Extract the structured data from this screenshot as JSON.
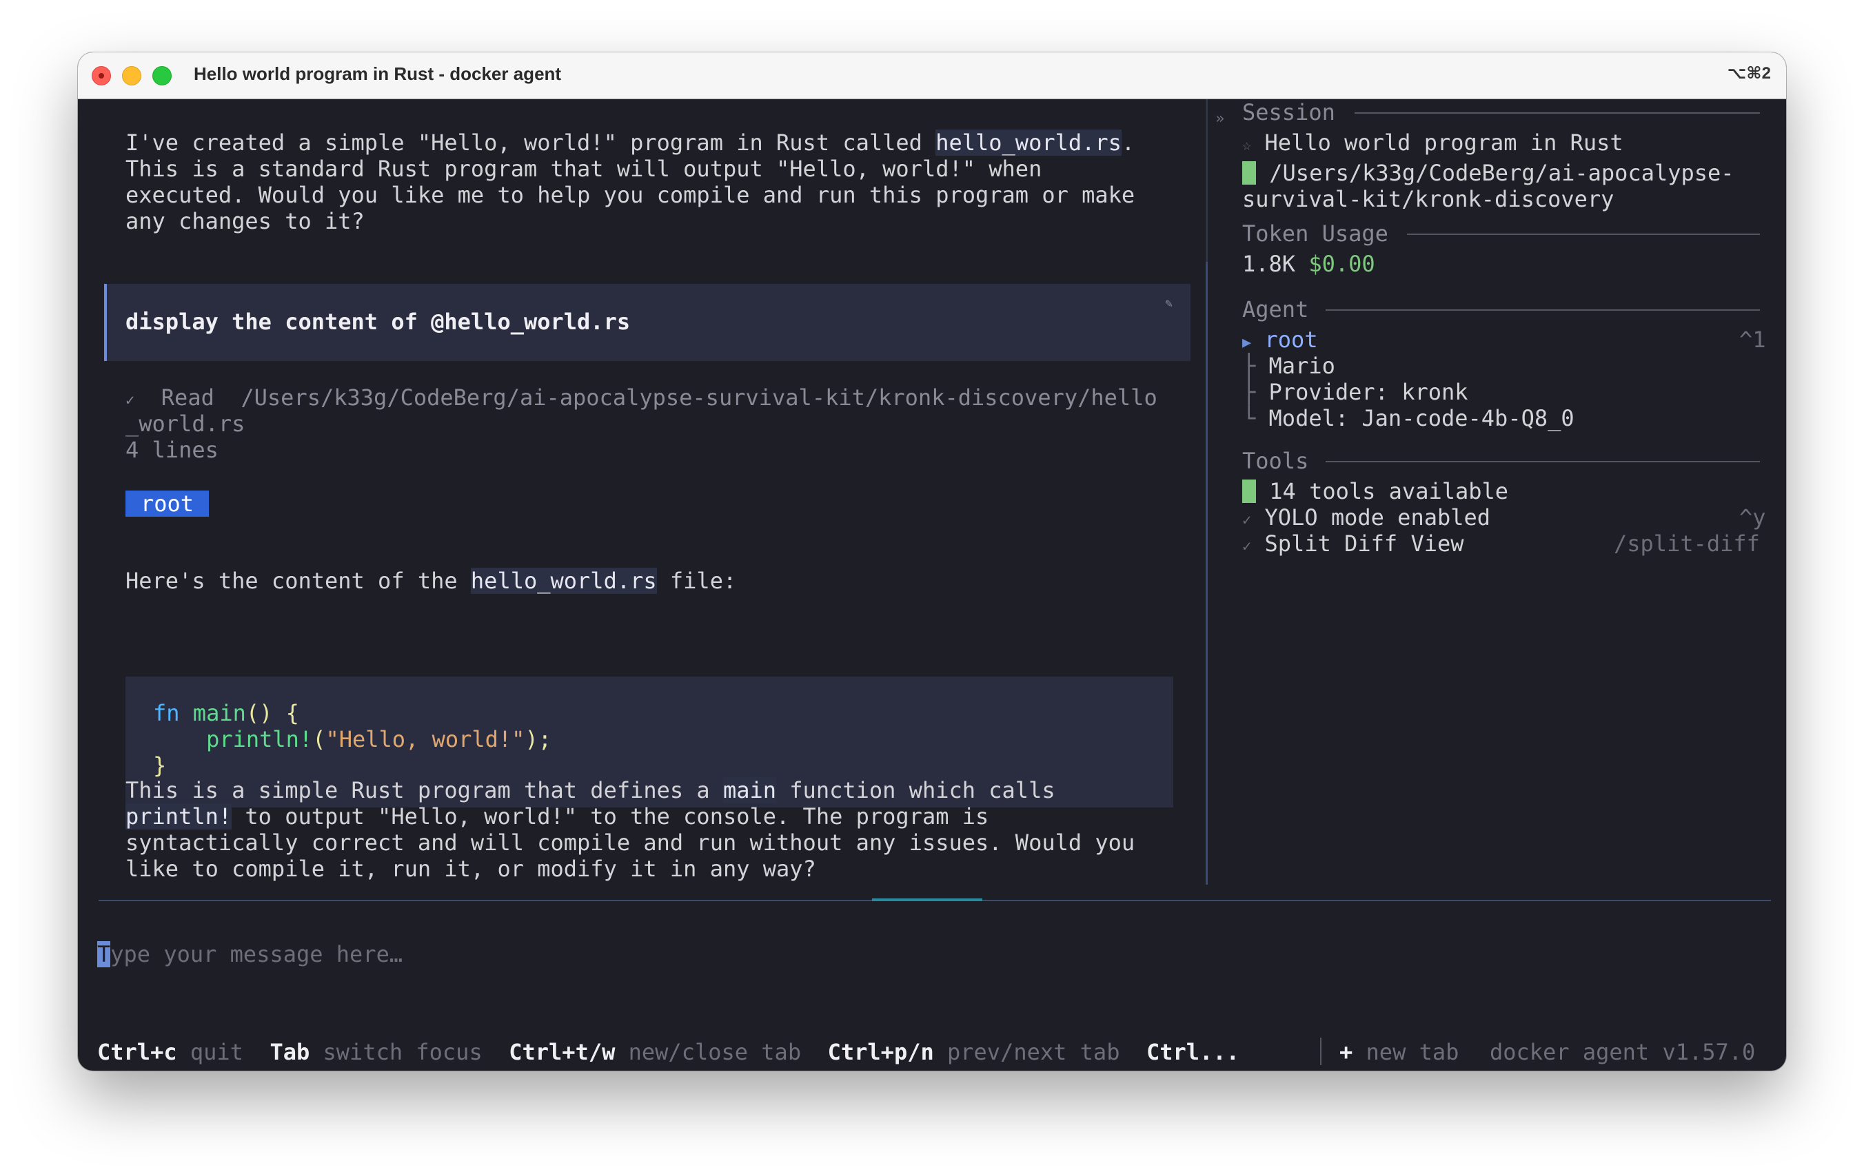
{
  "window": {
    "title": "Hello world program in Rust - docker agent",
    "shortcut": "⌥⌘2"
  },
  "chat": {
    "assistant_intro_lines": [
      "I've created a simple \"Hello, world!\" program in Rust called ",
      "hello_world.rs",
      ".",
      "This is a standard Rust program that will output \"Hello, world!\" when",
      "executed. Would you like me to help you compile and run this program or make",
      "any changes to it?"
    ],
    "user_message": "display the content of @hello_world.rs",
    "edit_icon": "pencil-icon",
    "tool_call": {
      "check": "✓",
      "label": "Read",
      "path_line1": "/Users/k33g/CodeBerg/ai-apocalypse-survival-kit/kronk-discovery/hello",
      "path_line2": "_world.rs",
      "result": "4 lines"
    },
    "agent_badge": "root",
    "reply_prefix": "Here's the content of the ",
    "reply_file": "hello_world.rs",
    "reply_suffix": " file:",
    "code": {
      "kw": "fn",
      "name": "main",
      "sig_rest": "() {",
      "macro": "println!",
      "paren_open": "(",
      "string": "\"Hello, world!\"",
      "paren_close": ");",
      "close": "}"
    },
    "explain": {
      "l1_a": "This is a simple Rust program that defines a ",
      "l1_code": "main",
      "l1_b": " function which calls",
      "l2_code": "println!",
      "l2_b": " to output \"Hello, world!\" to the console. The program is",
      "l3": "syntactically correct and will compile and run without any issues. Would you",
      "l4": "like to compile it, run it, or modify it in any way?"
    }
  },
  "sidebar": {
    "collapse": "»",
    "session": {
      "header": "Session",
      "star": "☆",
      "title": "Hello world program in Rust",
      "path_line1": "/Users/k33g/CodeBerg/ai-apocalypse-",
      "path_line2": "survival-kit/kronk-discovery"
    },
    "tokens": {
      "header": "Token Usage",
      "count": "1.8K",
      "cost": "$0.00"
    },
    "agent": {
      "header": "Agent",
      "arrow": "▶",
      "name": "root",
      "shortcut": "^1",
      "lines": [
        {
          "branch": "├",
          "text": "Mario"
        },
        {
          "branch": "├",
          "text": "Provider: kronk"
        },
        {
          "branch": "└",
          "text": "Model: Jan-code-4b-Q8_0"
        }
      ]
    },
    "tools": {
      "header": "Tools",
      "available": "14 tools available",
      "yolo": "YOLO mode enabled",
      "yolo_shortcut": "^y",
      "split": "Split Diff View",
      "split_command": "/split-diff",
      "check": "✓"
    }
  },
  "input": {
    "cursor_char": "T",
    "placeholder_rest": "ype your message here…"
  },
  "footer": {
    "items": [
      {
        "key": "Ctrl+c",
        "label": "quit"
      },
      {
        "key": "Tab",
        "label": "switch focus"
      },
      {
        "key": "Ctrl+t/w",
        "label": "new/close tab"
      },
      {
        "key": "Ctrl+p/n",
        "label": "prev/next tab"
      },
      {
        "key": "Ctrl...",
        "label": ""
      }
    ],
    "new_tab_plus": "+",
    "new_tab_label": "new tab",
    "version": "docker agent v1.57.0"
  },
  "colors": {
    "background": "#1e1e26",
    "accent_blue": "#2f63d9",
    "green": "#7fc97f",
    "keyword": "#4fb6ff",
    "string": "#e0a870"
  }
}
